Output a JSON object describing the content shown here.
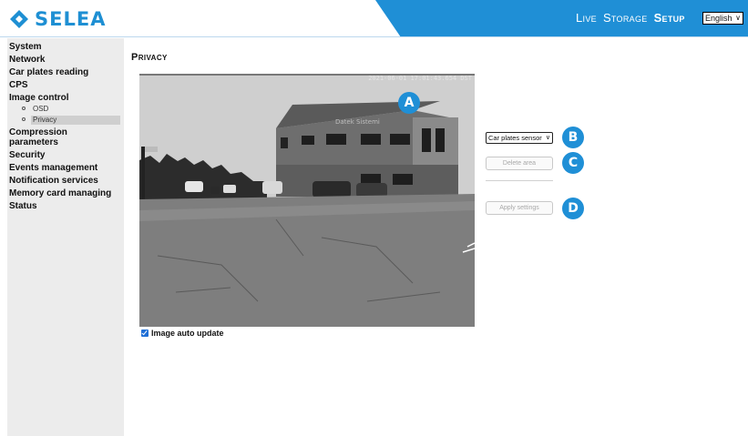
{
  "header": {
    "logo_text": "SELEA",
    "nav": [
      {
        "label": "Live",
        "active": false
      },
      {
        "label": "Storage",
        "active": false
      },
      {
        "label": "Setup",
        "active": true
      }
    ],
    "language": "English",
    "accent_color": "#1e8fd3"
  },
  "sidebar": {
    "items": [
      {
        "label": "System"
      },
      {
        "label": "Network"
      },
      {
        "label": "Car plates reading"
      },
      {
        "label": "CPS"
      },
      {
        "label": "Image control"
      }
    ],
    "subitems": [
      {
        "label": "OSD",
        "selected": false
      },
      {
        "label": "Privacy",
        "selected": true
      }
    ],
    "items_after": [
      {
        "label": "Compression parameters"
      },
      {
        "label": "Security"
      },
      {
        "label": "Events management"
      },
      {
        "label": "Notification services"
      },
      {
        "label": "Memory card managing"
      },
      {
        "label": "Status"
      }
    ]
  },
  "main": {
    "title": "Privacy",
    "camera": {
      "timestamp": "2021-06-01 17:01:43.654 DST",
      "building_sign": "Datek Sistemi"
    },
    "auto_update_label": "Image auto update",
    "auto_update_checked": true,
    "sensor_select": "Car plates sensor",
    "delete_button": "Delete area",
    "apply_button": "Apply settings",
    "badges": [
      "A",
      "B",
      "C",
      "D"
    ],
    "badge_color": "#1f8fd6"
  }
}
